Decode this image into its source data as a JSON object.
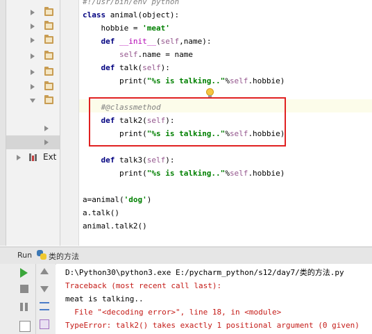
{
  "tree": {
    "library_label": "Ext"
  },
  "editor": {
    "lines": [
      {
        "segments": [
          {
            "t": "#!/usr/bin/env python",
            "c": "cmt"
          }
        ]
      },
      {
        "segments": [
          {
            "t": "class ",
            "c": "kw"
          },
          {
            "t": "animal(object):",
            "c": ""
          }
        ]
      },
      {
        "segments": [
          {
            "t": "    hobbie = ",
            "c": ""
          },
          {
            "t": "'meat'",
            "c": "str"
          }
        ]
      },
      {
        "segments": [
          {
            "t": "    ",
            "c": ""
          },
          {
            "t": "def ",
            "c": "kw"
          },
          {
            "t": "__init__",
            "c": "fn"
          },
          {
            "t": "(",
            "c": ""
          },
          {
            "t": "self",
            "c": "sf"
          },
          {
            "t": ",name):",
            "c": ""
          }
        ]
      },
      {
        "segments": [
          {
            "t": "        ",
            "c": ""
          },
          {
            "t": "self",
            "c": "sf"
          },
          {
            "t": ".name = name",
            "c": ""
          }
        ]
      },
      {
        "segments": [
          {
            "t": "    ",
            "c": ""
          },
          {
            "t": "def ",
            "c": "kw"
          },
          {
            "t": "talk(",
            "c": ""
          },
          {
            "t": "self",
            "c": "sf"
          },
          {
            "t": "):",
            "c": ""
          }
        ]
      },
      {
        "segments": [
          {
            "t": "        print(",
            "c": ""
          },
          {
            "t": "\"%s is talking..\"",
            "c": "str"
          },
          {
            "t": "%",
            "c": ""
          },
          {
            "t": "self",
            "c": "sf"
          },
          {
            "t": ".hobbie)",
            "c": ""
          }
        ]
      },
      {
        "segments": []
      },
      {
        "segments": [
          {
            "t": "    #@classmethod",
            "c": "cmt"
          }
        ]
      },
      {
        "segments": [
          {
            "t": "    ",
            "c": ""
          },
          {
            "t": "def ",
            "c": "kw"
          },
          {
            "t": "talk2(",
            "c": ""
          },
          {
            "t": "self",
            "c": "sf"
          },
          {
            "t": "):",
            "c": ""
          }
        ]
      },
      {
        "segments": [
          {
            "t": "        print(",
            "c": ""
          },
          {
            "t": "\"%s is talking..\"",
            "c": "str"
          },
          {
            "t": "%",
            "c": ""
          },
          {
            "t": "self",
            "c": "sf"
          },
          {
            "t": ".hobbie)",
            "c": ""
          }
        ]
      },
      {
        "segments": []
      },
      {
        "segments": [
          {
            "t": "    ",
            "c": ""
          },
          {
            "t": "def ",
            "c": "kw"
          },
          {
            "t": "talk3(",
            "c": ""
          },
          {
            "t": "self",
            "c": "sf"
          },
          {
            "t": "):",
            "c": ""
          }
        ]
      },
      {
        "segments": [
          {
            "t": "        print(",
            "c": ""
          },
          {
            "t": "\"%s is talking..\"",
            "c": "str"
          },
          {
            "t": "%",
            "c": ""
          },
          {
            "t": "self",
            "c": "sf"
          },
          {
            "t": ".hobbie)",
            "c": ""
          }
        ]
      },
      {
        "segments": []
      },
      {
        "segments": [
          {
            "t": "a=animal(",
            "c": ""
          },
          {
            "t": "'dog'",
            "c": "str"
          },
          {
            "t": ")",
            "c": ""
          }
        ]
      },
      {
        "segments": [
          {
            "t": "a.talk()",
            "c": ""
          }
        ]
      },
      {
        "segments": [
          {
            "t": "animal.talk2()",
            "c": ""
          }
        ]
      }
    ]
  },
  "run": {
    "tab_label": "Run",
    "config_name": "类的方法",
    "output": [
      {
        "text": "D:\\Python30\\python3.exe E:/pycharm_python/s12/day7/类的方法.py",
        "kind": "c-cmd"
      },
      {
        "text": "Traceback (most recent call last):",
        "kind": "c-err"
      },
      {
        "text": "meat is talking..",
        "kind": "c-out"
      },
      {
        "text": "  File \"<decoding error>\", line 18, in <module>",
        "kind": "c-err"
      },
      {
        "text": "TypeError: talk2() takes exactly 1 positional argument (0 given)",
        "kind": "c-err"
      }
    ]
  },
  "icons": {
    "run": "play-icon",
    "stop": "stop-icon",
    "pause": "pause-icon",
    "up": "arrow-up-icon",
    "down": "arrow-down-icon",
    "wrap": "soft-wrap-icon",
    "scroll": "scroll-to-end-icon",
    "bulb": "lightbulb-icon",
    "python": "python-icon"
  },
  "colors": {
    "keyword": "#000080",
    "string": "#008000",
    "self": "#94558d",
    "dunder": "#b200b2",
    "comment": "#808080",
    "error": "#c41a16",
    "highlight_box": "#e02020"
  }
}
